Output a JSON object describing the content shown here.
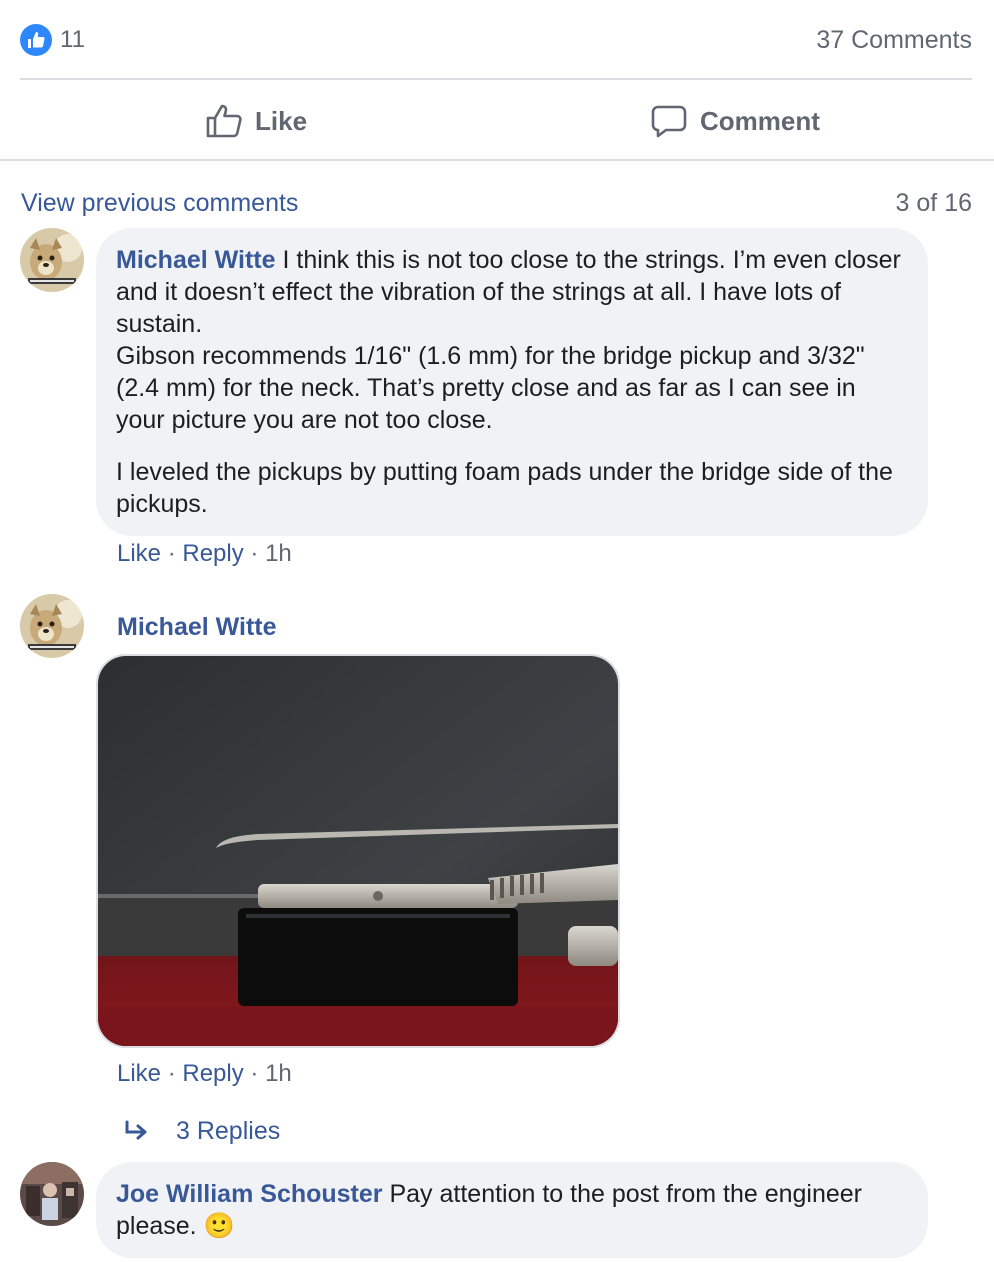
{
  "stats": {
    "like_count": "11",
    "comment_count": "37 Comments"
  },
  "actions": {
    "like_label": "Like",
    "comment_label": "Comment"
  },
  "comments_header": {
    "view_previous": "View previous comments",
    "page_count": "3 of 16"
  },
  "comments": [
    {
      "author": "Michael Witte",
      "text_1": " I think this is not too close to the strings. I’m even closer and it doesn’t effect the vibration of the strings at all. I have lots of sustain.",
      "text_2": "Gibson recommends 1/16\" (1.6 mm) for the bridge pickup and 3/32\" (2.4 mm) for the neck. That’s pretty close and as far as I can see in your picture you are not too close.",
      "text_3": "I leveled the pickups by putting foam pads under the bridge side of the pickups.",
      "like": "Like",
      "reply": "Reply",
      "time": "1h"
    },
    {
      "author": "Michael Witte",
      "like": "Like",
      "reply": "Reply",
      "time": "1h",
      "replies": "3 Replies"
    },
    {
      "author": "Joe William Schouster",
      "text": " Pay attention to the post from the engineer please. ",
      "emoji": "🙂"
    }
  ],
  "colors": {
    "link": "#385898",
    "meta": "#606770",
    "bubble": "#f0f2f5",
    "like_badge": "#2d88ff"
  }
}
